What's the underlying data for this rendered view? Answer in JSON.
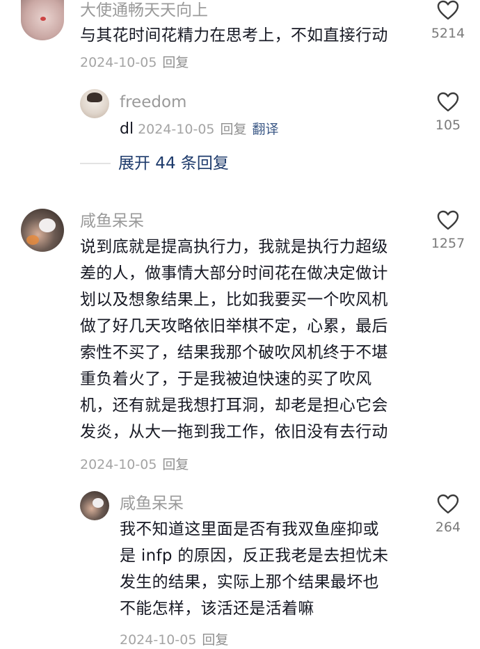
{
  "comments": [
    {
      "user": "大使通畅天天向上",
      "text_lines": [
        "与其花时间花精力在思考上，不如直接行动"
      ],
      "date": "2024-10-05",
      "reply_label": "回复",
      "likes": "5214"
    },
    {
      "user": "freedom",
      "prefix": "dl",
      "date": "2024-10-05",
      "reply_label": "回复",
      "translate_label": "翻译",
      "likes": "105"
    },
    {
      "user": "咸鱼呆呆",
      "text_lines": [
        "说到底就是提高执行力，我就是执行力超级",
        "差的人，做事情大部分时间花在做决定做计",
        "划以及想象结果上，比如我要买一个吹风机",
        "做了好几天攻略依旧举棋不定，心累，最后",
        "索性不买了，结果我那个破吹风机终于不堪",
        "重负着火了，于是我被迫快速的买了吹风",
        "机，还有就是我想打耳洞，却老是担心它会",
        "发炎，从大一拖到我工作，依旧没有去行动"
      ],
      "date": "2024-10-05",
      "reply_label": "回复",
      "likes": "1257"
    },
    {
      "user": "咸鱼呆呆",
      "text_lines": [
        "我不知道这里面是否有我双鱼座抑或",
        "是 infp 的原因，反正我老是去担忧未",
        "发生的结果，实际上那个结果最坏也",
        "不能怎样，该活还是活着嘛"
      ],
      "date": "2024-10-05",
      "reply_label": "回复",
      "likes": "264"
    }
  ],
  "expand_replies": "展开 44 条回复",
  "colors": {
    "text": "#161823",
    "username": "#9a9a9a",
    "meta": "#a4a4a4",
    "link": "#1d3a6b"
  },
  "icons": [
    "heart-outline-icon"
  ]
}
